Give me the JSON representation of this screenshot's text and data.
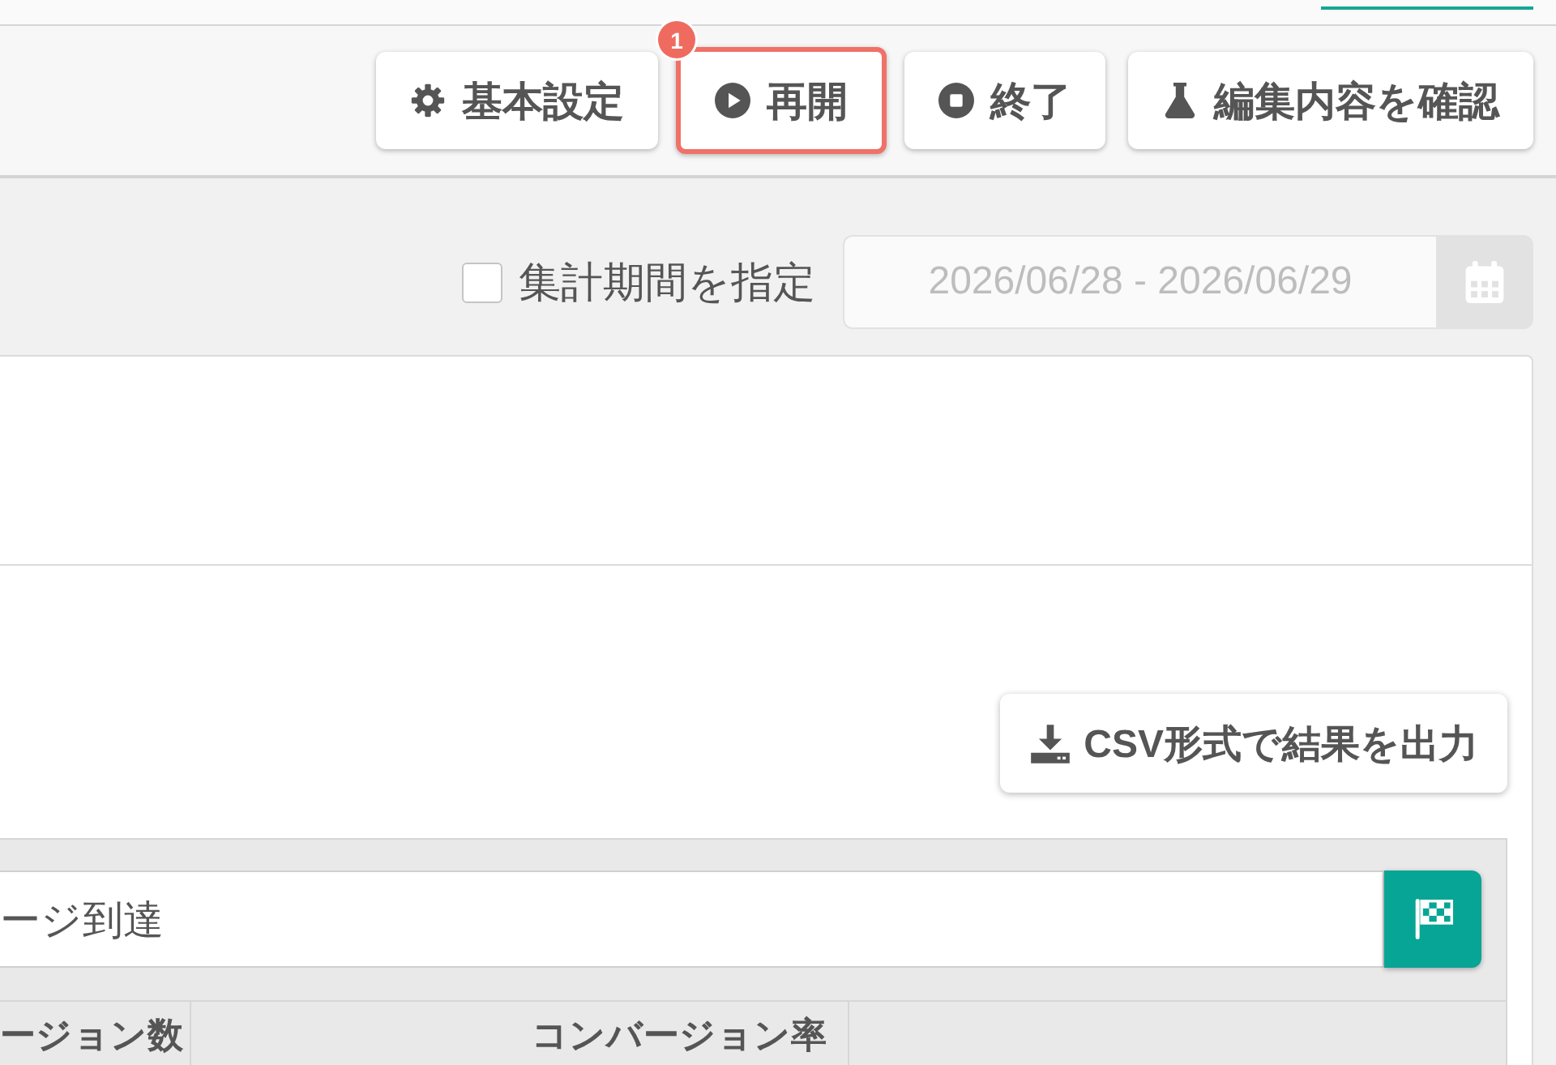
{
  "toolbar": {
    "buttons": [
      {
        "kind": "settings",
        "label": "基本設定",
        "highlighted": false
      },
      {
        "kind": "resume",
        "label": "再開",
        "highlighted": true,
        "badge": "1"
      },
      {
        "kind": "stop",
        "label": "終了",
        "highlighted": false
      },
      {
        "kind": "review",
        "label": "編集内容を確認",
        "highlighted": false
      }
    ]
  },
  "period_filter": {
    "label": "集計期間を指定",
    "checked": false,
    "date_range": {
      "value": "2026/06/28 - 2026/06/29",
      "disabled": true
    }
  },
  "results": {
    "export_button": {
      "label": "CSV形式で結果を出力"
    },
    "goal": {
      "value": "ージ到達"
    },
    "table": {
      "columns": [
        "ージョン数",
        "コンバージョン率"
      ]
    }
  }
}
